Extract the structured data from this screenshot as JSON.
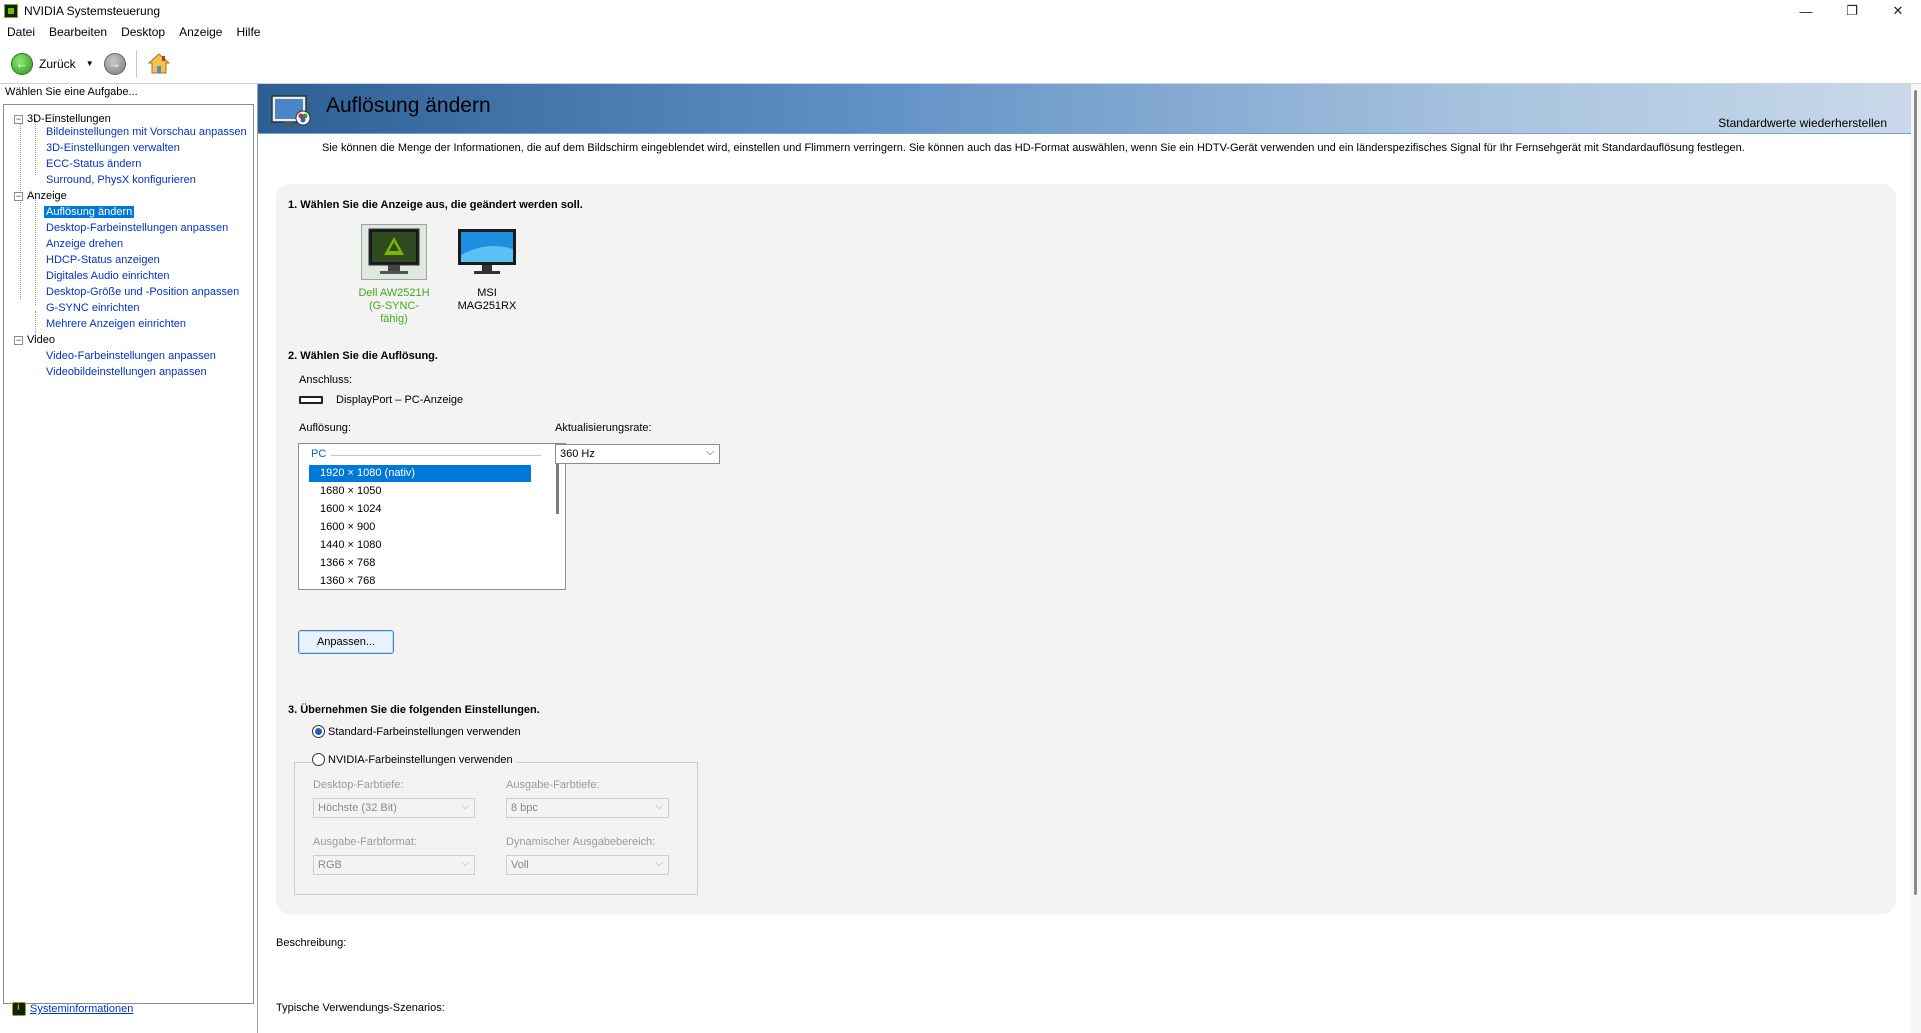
{
  "window": {
    "title": "NVIDIA Systemsteuerung",
    "minimize": "—",
    "maximize": "❐",
    "close": "✕"
  },
  "menu": [
    "Datei",
    "Bearbeiten",
    "Desktop",
    "Anzeige",
    "Hilfe"
  ],
  "toolbar": {
    "back_label": "Zurück",
    "back_arrow": "←",
    "forward_arrow": "→",
    "dropdown_arrow": "▼"
  },
  "sidebar": {
    "task_label": "Wählen Sie eine Aufgabe...",
    "categories": [
      {
        "label": "3D-Einstellungen",
        "toggle": "−",
        "items": [
          "Bildeinstellungen mit Vorschau anpassen",
          "3D-Einstellungen verwalten",
          "ECC-Status ändern",
          "Surround, PhysX konfigurieren"
        ]
      },
      {
        "label": "Anzeige",
        "toggle": "−",
        "items": [
          "Auflösung ändern",
          "Desktop-Farbeinstellungen anpassen",
          "Anzeige drehen",
          "HDCP-Status anzeigen",
          "Digitales Audio einrichten",
          "Desktop-Größe und -Position anpassen",
          "G-SYNC einrichten",
          "Mehrere Anzeigen einrichten"
        ]
      },
      {
        "label": "Video",
        "toggle": "−",
        "items": [
          "Video-Farbeinstellungen anpassen",
          "Videobildeinstellungen anpassen"
        ]
      }
    ],
    "selected_item": "Auflösung ändern",
    "system_info_link": "Systeminformationen"
  },
  "main": {
    "page_title": "Auflösung ändern",
    "restore_defaults": "Standardwerte wiederherstellen",
    "intro": "Sie können die Menge der Informationen, die auf dem Bildschirm eingeblendet wird, einstellen und Flimmern verringern. Sie können auch das HD-Format auswählen, wenn Sie ein HDTV-Gerät verwenden und ein länderspezifisches Signal für Ihr Fernsehgerät mit Standardauflösung festlegen.",
    "step1": {
      "title": "1. Wählen Sie die Anzeige aus, die geändert werden soll.",
      "displays": [
        {
          "name": "Dell AW2521H",
          "sub": "(G-SYNC-fähig)",
          "selected": true
        },
        {
          "name": "MSI MAG251RX",
          "sub": "",
          "selected": false
        }
      ]
    },
    "step2": {
      "title": "2. Wählen Sie die Auflösung.",
      "connection_label": "Anschluss:",
      "connection_value": "DisplayPort – PC-Anzeige",
      "resolution_label": "Auflösung:",
      "resolution_group": "PC",
      "resolutions": [
        "1920 × 1080 (nativ)",
        "1680 × 1050",
        "1600 × 1024",
        "1600 × 900",
        "1440 × 1080",
        "1366 × 768",
        "1360 × 768"
      ],
      "selected_resolution": "1920 × 1080 (nativ)",
      "refresh_label": "Aktualisierungsrate:",
      "refresh_value": "360 Hz",
      "customize_button": "Anpassen..."
    },
    "step3": {
      "title": "3. Übernehmen Sie die folgenden Einstellungen.",
      "radio_default": "Standard-Farbeinstellungen verwenden",
      "radio_nvidia": "NVIDIA-Farbeinstellungen verwenden",
      "selected": "default",
      "desktop_depth_label": "Desktop-Farbtiefe:",
      "desktop_depth_value": "Höchste (32 Bit)",
      "output_depth_label": "Ausgabe-Farbtiefe:",
      "output_depth_value": "8 bpc",
      "output_format_label": "Ausgabe-Farbformat:",
      "output_format_value": "RGB",
      "dynamic_range_label": "Dynamischer Ausgabebereich:",
      "dynamic_range_value": "Voll"
    },
    "description_label": "Beschreibung:",
    "scenarios_label": "Typische Verwendungs-Szenarios:"
  },
  "colors": {
    "accent_green": "#76b900",
    "selection_blue": "#0078d7",
    "link_blue": "#0033cc",
    "header_blue": "#2c5f94"
  },
  "icons": {
    "app": "nvidia-logo-icon",
    "home": "home-icon",
    "connector": "displayport-icon",
    "chevron": "chevron-down-icon"
  }
}
